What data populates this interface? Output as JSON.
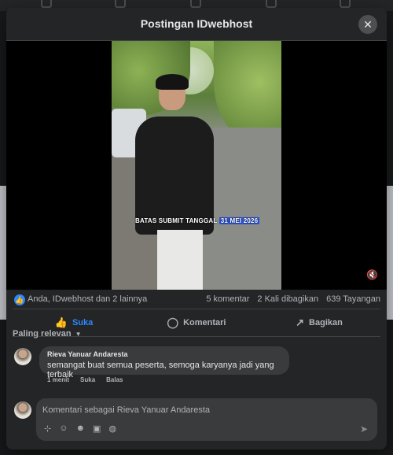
{
  "modal": {
    "title": "Postingan IDwebhost",
    "close_icon": "close-icon"
  },
  "video": {
    "caption_prefix": "BATAS SUBMIT TANGGAL",
    "caption_highlight": "31 MEI 2026",
    "caption_highlight_color": "#2d55d6",
    "mute_icon": "speaker-muted-icon"
  },
  "stats": {
    "like_icon": "like-badge-icon",
    "likes_text": "Anda, IDwebhost dan 2 lainnya",
    "comments": "5 komentar",
    "shares": "2 Kali dibagikan",
    "views": "639 Tayangan"
  },
  "actions": {
    "like_label": "Suka",
    "comment_label": "Komentari",
    "share_label": "Bagikan",
    "like_color": "#2d88ff"
  },
  "sort": {
    "label": "Paling relevan"
  },
  "comment": {
    "author": "Rieva Yanuar Andaresta",
    "text": "semangat buat semua peserta, semoga karyanya jadi yang terbaik",
    "time": "1 menit",
    "like_action": "Suka",
    "reply_action": "Balas"
  },
  "composer": {
    "placeholder": "Komentari sebagai Rieva Yanuar Andaresta",
    "tools": [
      "sticker-icon",
      "avatar-sticker-icon",
      "emoji-icon",
      "gif-icon",
      "sticker-face-icon"
    ],
    "send_icon": "send-icon"
  }
}
